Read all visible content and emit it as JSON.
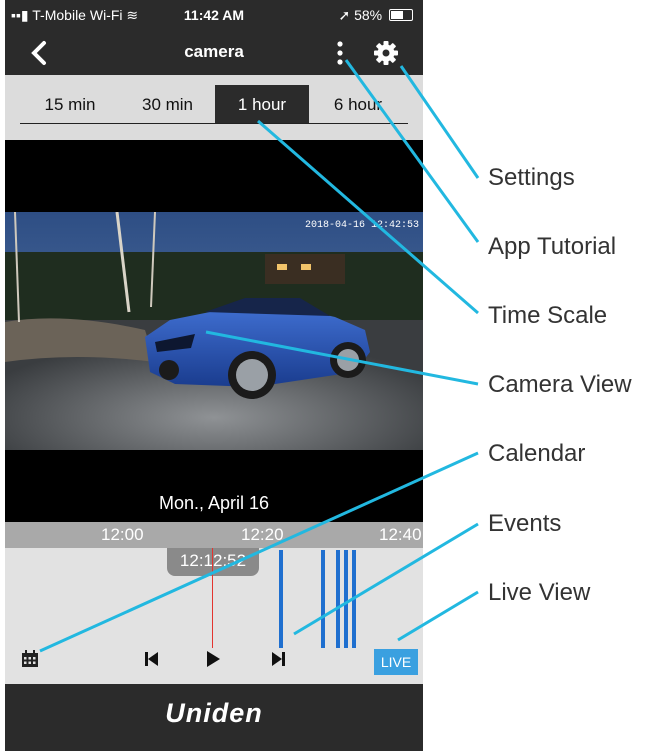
{
  "status_bar": {
    "carrier": "T-Mobile Wi-Fi",
    "time": "11:42 AM",
    "battery": "58%",
    "battery_level": 0.58
  },
  "header": {
    "title": "camera"
  },
  "time_scale": {
    "tabs": [
      "15 min",
      "30 min",
      "1 hour",
      "6 hour"
    ],
    "active": "1 hour"
  },
  "video": {
    "timestamp": "2018-04-16  12:42:53",
    "date": "Mon., April 16"
  },
  "timeline": {
    "labels": [
      "12:00",
      "12:20",
      "12:40"
    ],
    "cursor_time": "12:12:52",
    "live_label": "LIVE"
  },
  "footer": {
    "brand": "Uniden"
  },
  "annotations": {
    "settings": "Settings",
    "app_tutorial": "App Tutorial",
    "time_scale": "Time Scale",
    "camera_view": "Camera View",
    "calendar": "Calendar",
    "events": "Events",
    "live_view": "Live View"
  },
  "colors": {
    "accent": "#3aa0e0",
    "leader": "#22b8e0",
    "event": "#1f6fcf",
    "playhead": "#e3342f",
    "bar": "#2b2b2b"
  }
}
